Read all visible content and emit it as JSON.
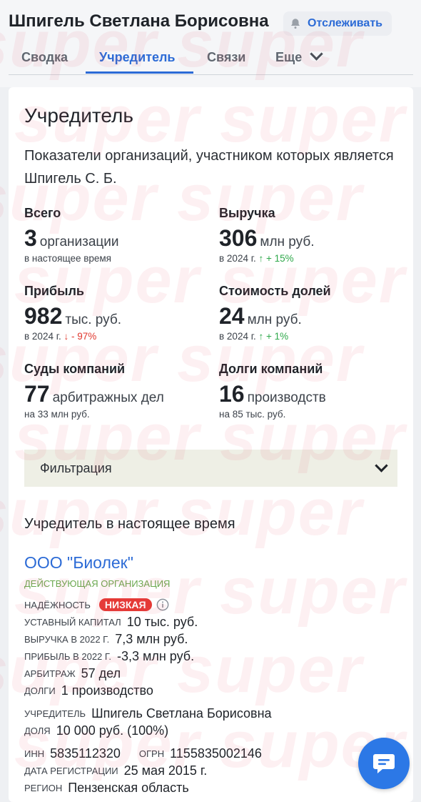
{
  "header": {
    "person_name": "Шпигель Светлана Борисовна",
    "track_label": "Отслеживать",
    "track_icon": "bell-icon"
  },
  "tabs": [
    {
      "label": "Сводка",
      "active": false
    },
    {
      "label": "Учредитель",
      "active": true
    },
    {
      "label": "Связи",
      "active": false
    },
    {
      "label": "Еще",
      "active": false
    }
  ],
  "section": {
    "title": "Учредитель",
    "lead": "Показатели организаций, участником которых является Шпигель С. Б."
  },
  "stats": {
    "total": {
      "label": "Всего",
      "value": "3",
      "unit": "организации",
      "sub": "в настоящее время"
    },
    "revenue": {
      "label": "Выручка",
      "value": "306",
      "unit": "млн руб.",
      "sub_year": "в 2024 г.",
      "change": "↑ + 15%"
    },
    "profit": {
      "label": "Прибыль",
      "value": "982",
      "unit": "тыс. руб.",
      "sub_year": "в 2024 г.",
      "change": "↓ - 97%"
    },
    "shares": {
      "label": "Стоимость долей",
      "value": "24",
      "unit": "млн руб.",
      "sub_year": "в 2024 г.",
      "change": "↑ + 1%"
    },
    "courts": {
      "label": "Суды компаний",
      "value": "77",
      "unit": "арбитражных дел",
      "sub": "на 33 млн руб."
    },
    "debts": {
      "label": "Долги компаний",
      "value": "16",
      "unit": "производств",
      "sub": "на 85 тыс. руб."
    }
  },
  "filter": {
    "label": "Фильтрация"
  },
  "current": {
    "title": "Учредитель в настоящее время"
  },
  "org": {
    "name": "ООО \"Биолек\"",
    "status": "Действующая организация",
    "reliability_label": "Надёжность",
    "reliability_value": "НИЗКАЯ",
    "capital_label": "Уставный капитал",
    "capital_value": "10 тыс. руб.",
    "revenue_label": "Выручка в 2022 г.",
    "revenue_value": "7,3 млн руб.",
    "profit_label": "Прибыль в 2022 г.",
    "profit_value": "-3,3 млн руб.",
    "arbitrage_label": "Арбитраж",
    "arbitrage_value": "57 дел",
    "debts_label": "Долги",
    "debts_value": "1 производство",
    "founder_label": "Учредитель",
    "founder_value": "Шпигель Светлана Борисовна",
    "share_label": "Доля",
    "share_value": "10 000 руб. (100%)",
    "inn_label": "ИНН",
    "inn_value": "5835112320",
    "ogrn_label": "ОГРН",
    "ogrn_value": "1155835002146",
    "regdate_label": "Дата регистрации",
    "regdate_value": "25 мая 2015 г.",
    "region_label": "Регион",
    "region_value": "Пензенская область"
  },
  "colors": {
    "accent": "#2c6bd6",
    "badge": "#e53935",
    "up": "#2ea84a",
    "down": "#e0362c",
    "status": "#6aa84f"
  },
  "watermark_text": "super super"
}
